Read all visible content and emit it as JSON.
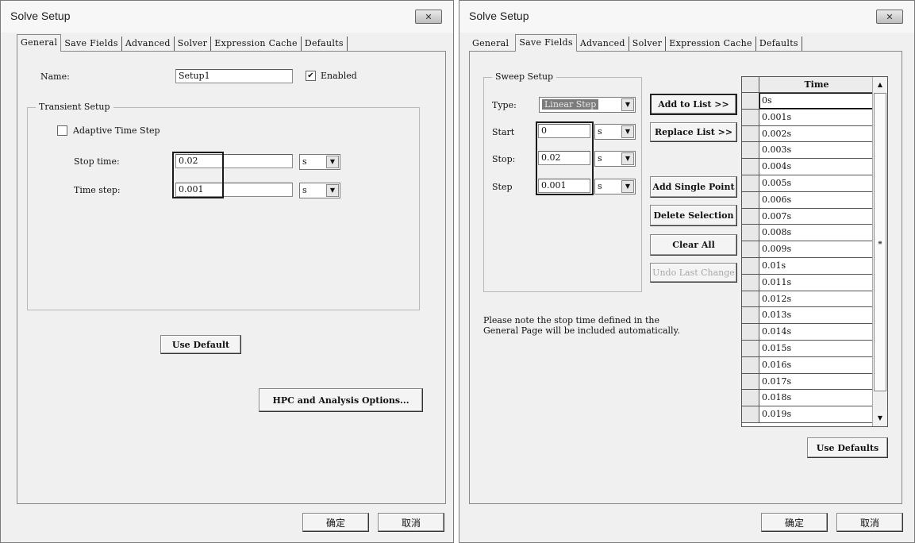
{
  "left_dialog": {
    "title": "Solve Setup",
    "close_label": "✕",
    "tabs": [
      {
        "label": "General",
        "active": true
      },
      {
        "label": "Save Fields",
        "active": false
      },
      {
        "label": "Advanced",
        "active": false
      },
      {
        "label": "Solver",
        "active": false
      },
      {
        "label": "Expression Cache",
        "active": false
      },
      {
        "label": "Defaults",
        "active": false
      }
    ],
    "name_label": "Name:",
    "name_value": "Setup1",
    "enabled_label": "Enabled",
    "enabled_checked": "✔",
    "transient_group_title": "Transient Setup",
    "adaptive_label": "Adaptive Time Step",
    "adaptive_checked": "",
    "stop_time_label": "Stop time:",
    "stop_time_value": "0.02",
    "stop_time_unit": "s",
    "time_step_label": "Time step:",
    "time_step_value": "0.001",
    "time_step_unit": "s",
    "use_default_label": "Use Default",
    "hpc_button_label": "HPC and Analysis Options...",
    "ok_label": "确定",
    "cancel_label": "取消"
  },
  "right_dialog": {
    "title": "Solve Setup",
    "close_label": "✕",
    "tabs": [
      {
        "label": "General",
        "active": false
      },
      {
        "label": "Save Fields",
        "active": true
      },
      {
        "label": "Advanced",
        "active": false
      },
      {
        "label": "Solver",
        "active": false
      },
      {
        "label": "Expression Cache",
        "active": false
      },
      {
        "label": "Defaults",
        "active": false
      }
    ],
    "sweep_group_title": "Sweep Setup",
    "type_label": "Type:",
    "type_value": "Linear Step",
    "start_label": "Start",
    "start_value": "0",
    "start_unit": "s",
    "stop_label": "Stop:",
    "stop_value": "0.02",
    "stop_unit": "s",
    "step_label": "Step",
    "step_value": "0.001",
    "step_unit": "s",
    "add_to_list_label": "Add to List >>",
    "replace_list_label": "Replace List >>",
    "add_single_point_label": "Add Single Point",
    "delete_selection_label": "Delete Selection",
    "clear_all_label": "Clear All",
    "undo_last_change_label": "Undo Last Change",
    "note_text": "Please note the stop time defined in the\nGeneral Page will be included automatically.",
    "time_column_header": "Time",
    "time_values": [
      "0s",
      "0.001s",
      "0.002s",
      "0.003s",
      "0.004s",
      "0.005s",
      "0.006s",
      "0.007s",
      "0.008s",
      "0.009s",
      "0.01s",
      "0.011s",
      "0.012s",
      "0.013s",
      "0.014s",
      "0.015s",
      "0.016s",
      "0.017s",
      "0.018s",
      "0.019s"
    ],
    "scroll_up": "▲",
    "scroll_down": "▼",
    "scroll_grip": "≡",
    "use_defaults_label": "Use Defaults",
    "ok_label": "确定",
    "cancel_label": "取消"
  },
  "dropdown_arrow": "▼"
}
